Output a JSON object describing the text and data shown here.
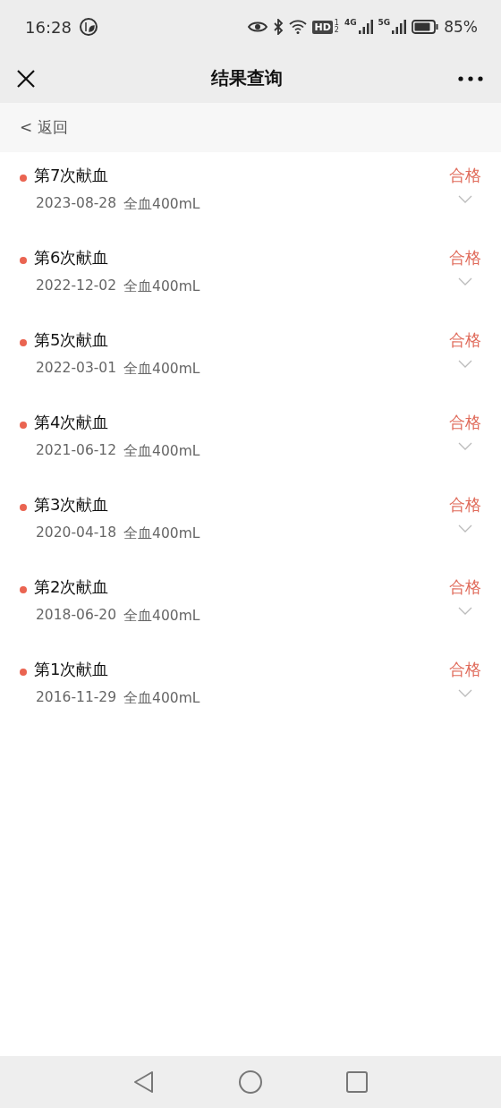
{
  "status_bar": {
    "time": "16:28",
    "hd": "HD",
    "hd_sub": [
      "1",
      "2"
    ],
    "net_1": "4G",
    "net_2": "5G",
    "battery": "85%"
  },
  "nav_bar": {
    "title": "结果查询"
  },
  "back_link": "< 返回",
  "records": [
    {
      "title": "第7次献血",
      "date": "2023-08-28",
      "type": "全血400mL",
      "result": "合格",
      "expanded": false
    },
    {
      "title": "第6次献血",
      "date": "2022-12-02",
      "type": "全血400mL",
      "result": "合格",
      "expanded": false
    },
    {
      "title": "第5次献血",
      "date": "2022-03-01",
      "type": "全血400mL",
      "result": "合格",
      "expanded": false
    },
    {
      "title": "第4次献血",
      "date": "2021-06-12",
      "type": "全血400mL",
      "result": "合格",
      "expanded": false
    },
    {
      "title": "第3次献血",
      "date": "2020-04-18",
      "type": "全血400mL",
      "result": "合格",
      "expanded": false
    },
    {
      "title": "第2次献血",
      "date": "2018-06-20",
      "type": "全血400mL",
      "result": "合格",
      "expanded": false
    },
    {
      "title": "第1次献血",
      "date": "2016-11-29",
      "type": "全血400mL",
      "result": "合格",
      "expanded": false
    }
  ]
}
